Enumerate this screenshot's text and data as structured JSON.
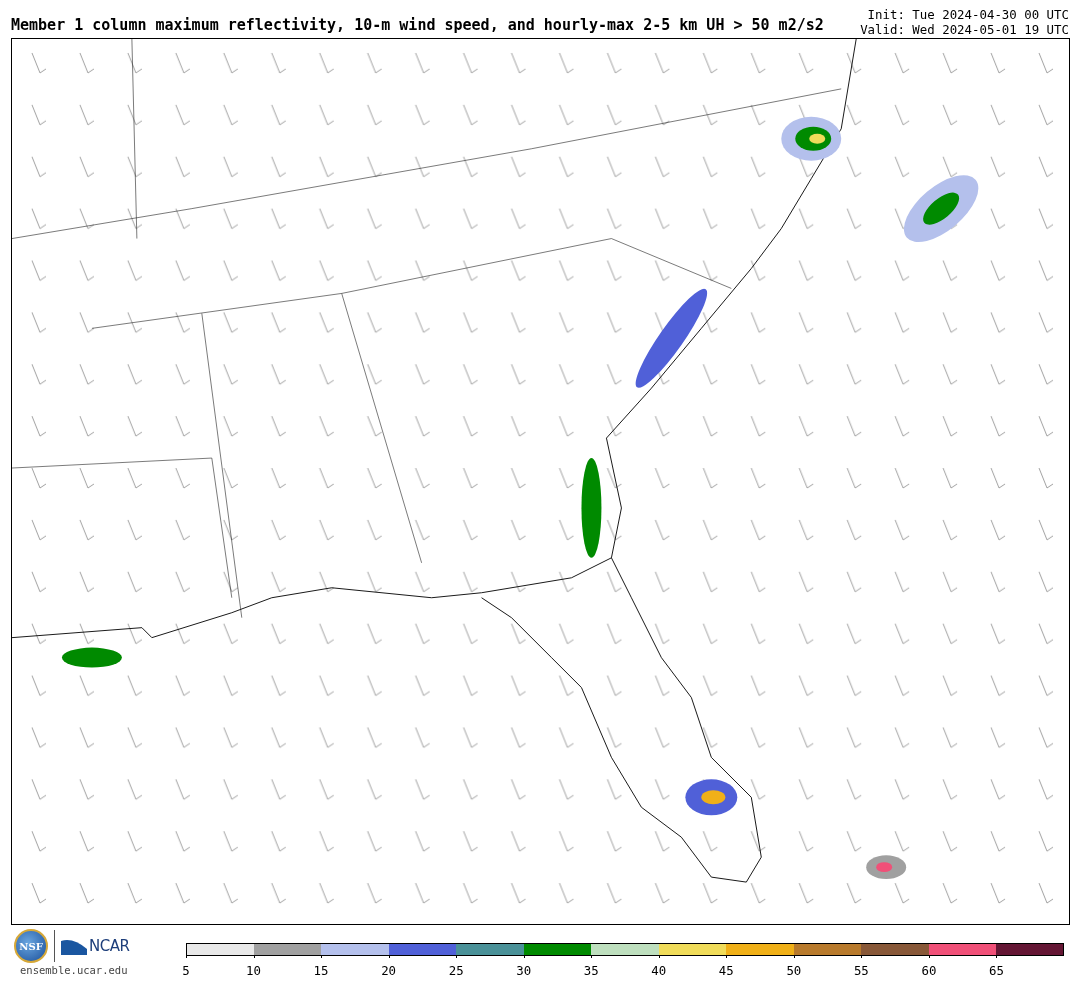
{
  "title": "Member 1 column maximum reflectivity, 10-m wind speed, and hourly-max 2-5 km UH > 50 m2/s2",
  "init": "Init: Tue 2024-04-30 00 UTC",
  "valid": "Valid: Wed 2024-05-01 19 UTC",
  "logos": {
    "nsf": "NSF",
    "ncar": "NCAR",
    "site": "ensemble.ucar.edu"
  },
  "colorbar": {
    "segments": [
      {
        "color": "#e8e8e8"
      },
      {
        "color": "#a0a0a0"
      },
      {
        "color": "#b4c0ec"
      },
      {
        "color": "#5060d8"
      },
      {
        "color": "#4a9198"
      },
      {
        "color": "#008a00"
      },
      {
        "color": "#bedfbe"
      },
      {
        "color": "#f0dc5a"
      },
      {
        "color": "#f0b018"
      },
      {
        "color": "#b87a2c"
      },
      {
        "color": "#885838"
      },
      {
        "color": "#f05078"
      },
      {
        "color": "#641634"
      }
    ],
    "ticks": [
      "5",
      "10",
      "15",
      "20",
      "25",
      "30",
      "35",
      "40",
      "45",
      "50",
      "55",
      "60",
      "65"
    ]
  }
}
